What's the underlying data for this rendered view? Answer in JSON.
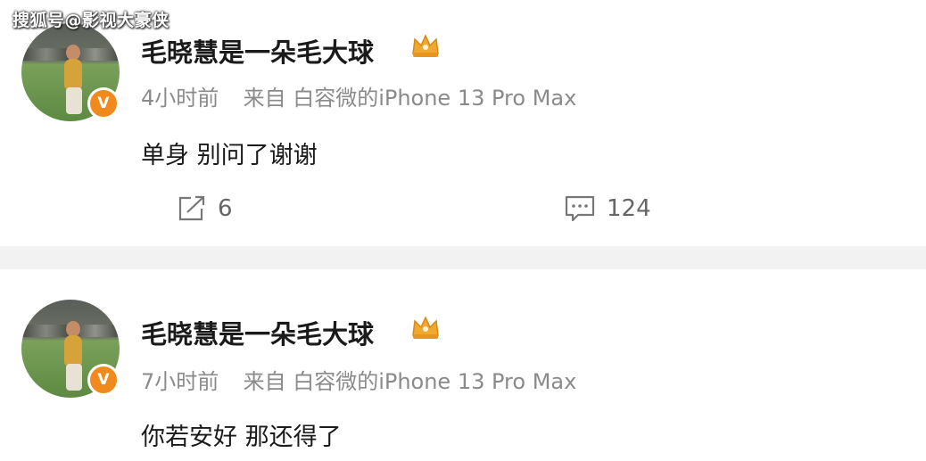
{
  "watermark": "搜狐号@影视大豪侠",
  "posts": [
    {
      "username": "毛晓慧是一朵毛大球",
      "time": "4小时前",
      "source": "来自 白容微的iPhone 13 Pro Max",
      "content": "单身 别问了谢谢",
      "repost_count": "6",
      "comment_count": "124"
    },
    {
      "username": "毛晓慧是一朵毛大球",
      "time": "7小时前",
      "source": "来自 白容微的iPhone 13 Pro Max",
      "content": "你若安好 那还得了"
    }
  ],
  "icons": {
    "verified": "V",
    "crown": "crown-icon",
    "repost": "repost-icon",
    "comment": "comment-icon"
  },
  "colors": {
    "verified_badge": "#f08a1c",
    "crown": "#f0a830",
    "meta_text": "#8a8a8a",
    "divider": "#f2f2f2"
  }
}
